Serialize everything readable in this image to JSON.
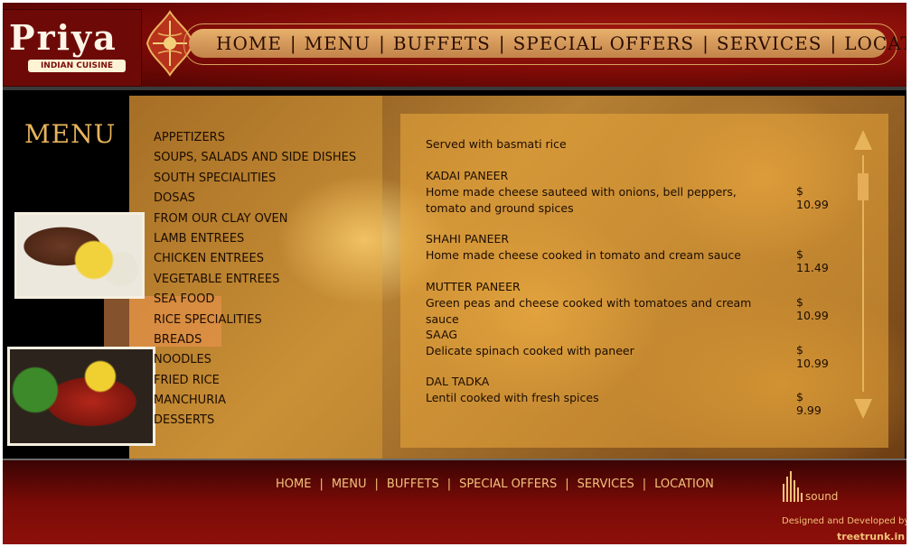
{
  "logo": {
    "name": "Priya",
    "tagline": "INDIAN CUISINE"
  },
  "nav": [
    "HOME",
    "MENU",
    "BUFFETS",
    "SPECIAL OFFERS",
    "SERVICES",
    "LOCATION"
  ],
  "menu_heading": "MENU",
  "categories": [
    "APPETIZERS",
    "SOUPS, SALADS AND SIDE DISHES",
    "SOUTH SPECIALITIES",
    "DOSAS",
    "FROM OUR CLAY OVEN",
    "LAMB ENTREES",
    "CHICKEN ENTREES",
    "VEGETABLE ENTREES",
    "SEA FOOD",
    "RICE SPECIALITIES",
    "BREADS",
    "NOODLES",
    "FRIED RICE",
    "MANCHURIA",
    "DESSERTS"
  ],
  "intro": "Served with basmati rice",
  "items": [
    {
      "name": "KADAI PANEER",
      "description": "Home made cheese sauteed with onions, bell peppers, tomato and ground spices",
      "price": "$ 10.99"
    },
    {
      "name": "SHAHI PANEER",
      "description": "Home made cheese cooked in tomato and cream sauce",
      "price": "$ 11.49"
    },
    {
      "name": "MUTTER PANEER",
      "description": "Green peas and cheese cooked with tomatoes and cream sauce",
      "price": "$ 10.99"
    },
    {
      "name": "SAAG",
      "description": "Delicate spinach cooked with paneer",
      "price": "$ 10.99"
    },
    {
      "name": "DAL TADKA",
      "description": "Lentil cooked with fresh spices",
      "price": "$ 9.99"
    }
  ],
  "footer": {
    "nav": [
      "HOME",
      "MENU",
      "BUFFETS",
      "SPECIAL OFFERS",
      "SERVICES",
      "LOCATION"
    ],
    "sound_label": "sound",
    "designed_by": "Designed and Developed by",
    "developer": "treetrunk.in"
  },
  "colors": {
    "accent": "#e7b45c",
    "header_red": "#7a0a06",
    "panel": "#ecaa3c"
  },
  "icons": [
    "emblem-icon",
    "scroll-up-arrow-icon",
    "scroll-down-arrow-icon",
    "sound-bars-icon"
  ]
}
